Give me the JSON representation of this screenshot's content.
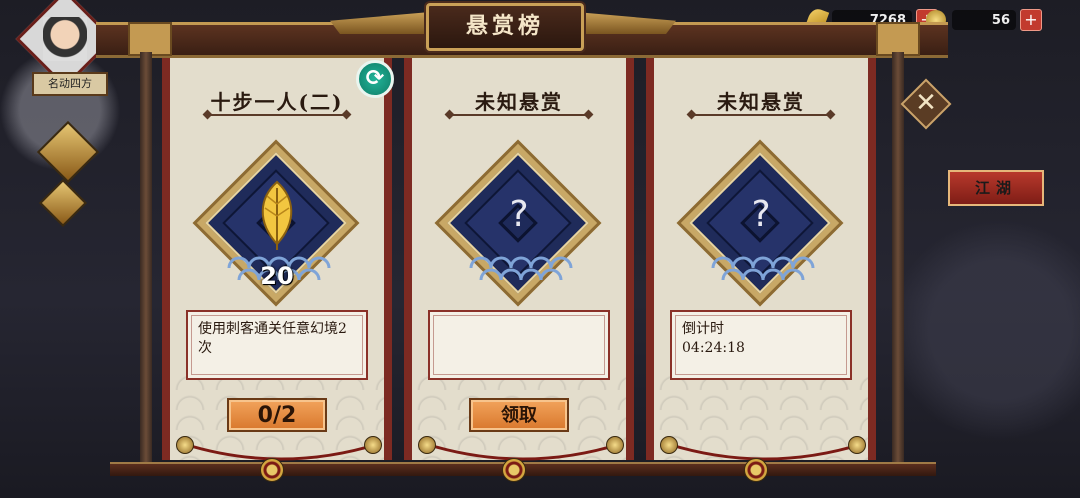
{
  "header": {
    "title": "悬赏榜"
  },
  "resources": [
    {
      "icon": "leaf-icon",
      "value": "7268"
    },
    {
      "icon": "coin-icon",
      "value": "56"
    }
  ],
  "player": {
    "name": "名动四方"
  },
  "side": {
    "tag_label": "江湖"
  },
  "cards": [
    {
      "title": "十步一人(二)",
      "symbol": "",
      "reward_count": "20",
      "description": "使用刺客通关任意幻境2次",
      "button_label": "0/2"
    },
    {
      "title": "未知悬赏",
      "symbol": "?",
      "reward_count": "",
      "description": "",
      "button_label": "领取"
    },
    {
      "title": "未知悬赏",
      "symbol": "?",
      "reward_count": "",
      "description_label": "倒计时",
      "description_time": "04:24:18",
      "button_label": ""
    }
  ],
  "colors": {
    "card_bg": "#e3ddcc",
    "card_border": "#7d2a22",
    "button_orange": "#e58d44",
    "diamond_blue": "#1f2b5a",
    "refresh_green": "#18a084"
  }
}
